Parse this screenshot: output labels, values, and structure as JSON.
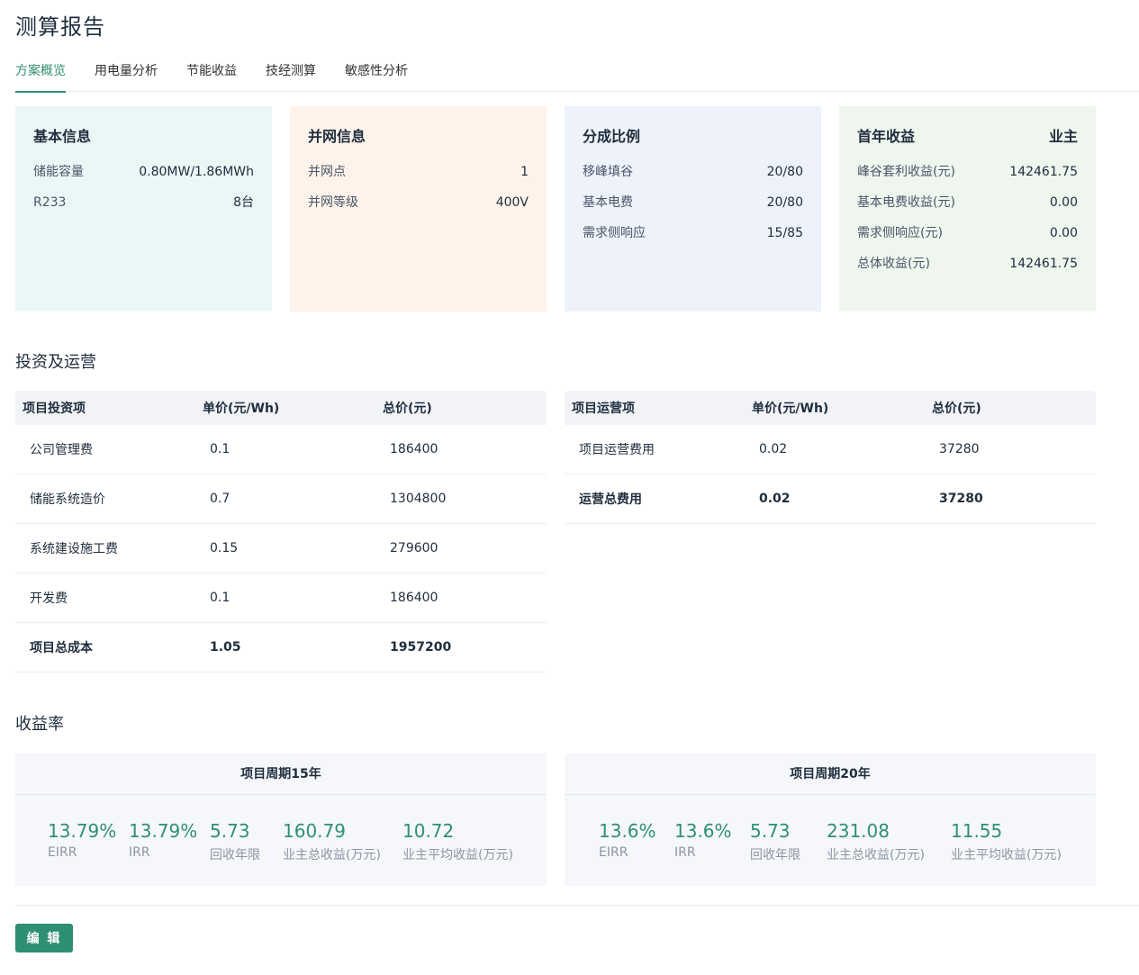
{
  "page": {
    "title": "测算报告"
  },
  "tabs": [
    {
      "label": "方案概览",
      "active": true
    },
    {
      "label": "用电量分析"
    },
    {
      "label": "节能收益"
    },
    {
      "label": "技经测算"
    },
    {
      "label": "敏感性分析"
    }
  ],
  "cards": {
    "basic": {
      "title": "基本信息",
      "rows": [
        {
          "k": "储能容量",
          "v": "0.80MW/1.86MWh"
        },
        {
          "k": "R233",
          "v": "8台"
        }
      ]
    },
    "grid": {
      "title": "并网信息",
      "rows": [
        {
          "k": "并网点",
          "v": "1"
        },
        {
          "k": "并网等级",
          "v": "400V"
        }
      ]
    },
    "share": {
      "title": "分成比例",
      "rows": [
        {
          "k": "移峰填谷",
          "v": "20/80"
        },
        {
          "k": "基本电费",
          "v": "20/80"
        },
        {
          "k": "需求侧响应",
          "v": "15/85"
        }
      ]
    },
    "income": {
      "title": "首年收益",
      "owner": "业主",
      "rows": [
        {
          "k": "峰谷套利收益(元)",
          "v": "142461.75"
        },
        {
          "k": "基本电费收益(元)",
          "v": "0.00"
        },
        {
          "k": "需求侧响应(元)",
          "v": "0.00"
        },
        {
          "k": "总体收益(元)",
          "v": "142461.75"
        }
      ]
    }
  },
  "invest_section": {
    "title": "投资及运营"
  },
  "invest_table": {
    "headers": [
      "项目投资项",
      "单价(元/Wh)",
      "总价(元)"
    ],
    "rows": [
      [
        "公司管理费",
        "0.1",
        "186400"
      ],
      [
        "储能系统造价",
        "0.7",
        "1304800"
      ],
      [
        "系统建设施工费",
        "0.15",
        "279600"
      ],
      [
        "开发费",
        "0.1",
        "186400"
      ],
      [
        "项目总成本",
        "1.05",
        "1957200"
      ]
    ]
  },
  "ops_table": {
    "headers": [
      "项目运营项",
      "单价(元/Wh)",
      "总价(元)"
    ],
    "rows": [
      [
        "项目运营费用",
        "0.02",
        "37280"
      ],
      [
        "运营总费用",
        "0.02",
        "37280"
      ]
    ]
  },
  "yield_section": {
    "title": "收益率"
  },
  "yield15": {
    "title": "项目周期15年",
    "metrics": [
      {
        "val": "13.79%",
        "lbl": "EIRR"
      },
      {
        "val": "13.79%",
        "lbl": "IRR"
      },
      {
        "val": "5.73",
        "lbl": "回收年限"
      },
      {
        "val": "160.79",
        "lbl": "业主总收益(万元)"
      },
      {
        "val": "10.72",
        "lbl": "业主平均收益(万元)"
      }
    ]
  },
  "yield20": {
    "title": "项目周期20年",
    "metrics": [
      {
        "val": "13.6%",
        "lbl": "EIRR"
      },
      {
        "val": "13.6%",
        "lbl": "IRR"
      },
      {
        "val": "5.73",
        "lbl": "回收年限"
      },
      {
        "val": "231.08",
        "lbl": "业主总收益(万元)"
      },
      {
        "val": "11.55",
        "lbl": "业主平均收益(万元)"
      }
    ]
  },
  "actions": {
    "edit_label": "编 辑"
  },
  "colors": {
    "accent": "#2f8f73",
    "card_basic": "#ebf6f7",
    "card_grid": "#fdf3ea",
    "card_share": "#edf2fb",
    "card_income": "#eef6ee"
  }
}
